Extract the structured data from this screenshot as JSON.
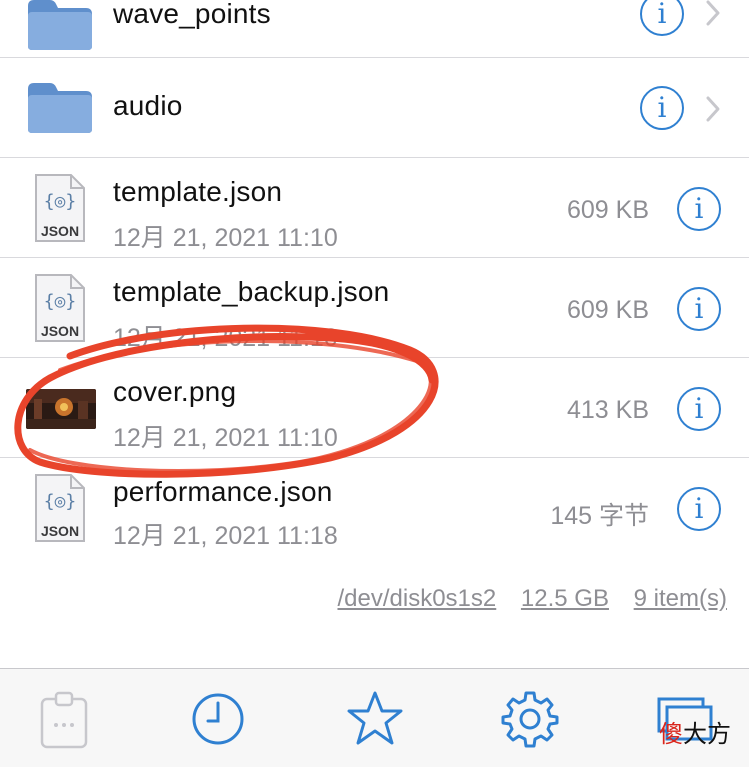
{
  "colors": {
    "accent": "#2f80d1",
    "folder": "#7fa7d9",
    "annotation": "#e8442b"
  },
  "files": [
    {
      "name": "wave_points",
      "kind": "folder"
    },
    {
      "name": "audio",
      "kind": "folder"
    },
    {
      "name": "template.json",
      "kind": "json",
      "date": "12月 21, 2021 11:10",
      "size": "609 KB"
    },
    {
      "name": "template_backup.json",
      "kind": "json",
      "date": "12月 21, 2021 11:10",
      "size": "609 KB"
    },
    {
      "name": "cover.png",
      "kind": "image",
      "date": "12月 21, 2021 11:10",
      "size": "413 KB"
    },
    {
      "name": "performance.json",
      "kind": "json",
      "date": "12月 21, 2021 11:18",
      "size": "145 字节"
    }
  ],
  "icons": {
    "json_label": "JSON",
    "info_glyph": "i"
  },
  "footer": {
    "disk": "/dev/disk0s1s2",
    "capacity": "12.5 GB",
    "count": "9 item(s)"
  },
  "tabbar": [
    "clipboard-icon",
    "recents-clock-icon",
    "favorites-star-icon",
    "settings-gear-icon",
    "windows-icon"
  ],
  "watermark": {
    "part1": "傻",
    "part2": "大方"
  }
}
